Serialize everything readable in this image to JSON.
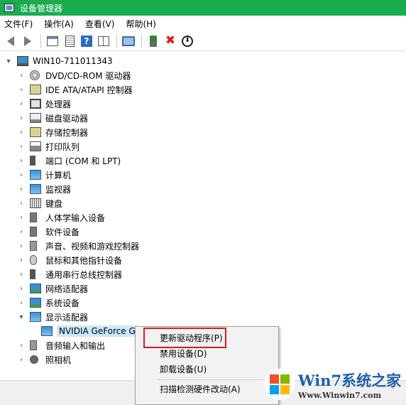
{
  "window": {
    "title": "设备管理器"
  },
  "menu": [
    "文件(F)",
    "操作(A)",
    "查看(V)",
    "帮助(H)"
  ],
  "toolbar": {
    "icons": [
      "back-arrow-icon",
      "forward-arrow-icon",
      "window-icon",
      "document-icon",
      "help-icon",
      "properties-icon",
      "monitor-icon",
      "enable-device-icon",
      "uninstall-x-icon",
      "download-circle-icon"
    ],
    "help_glyph": "?",
    "x_glyph": "✖",
    "down_glyph": "⬇"
  },
  "tree": {
    "root": "WIN10-711011343",
    "categories": [
      "DVD/CD-ROM 驱动器",
      "IDE ATA/ATAPI 控制器",
      "处理器",
      "磁盘驱动器",
      "存储控制器",
      "打印队列",
      "端口 (COM 和 LPT)",
      "计算机",
      "监视器",
      "键盘",
      "人体学输入设备",
      "软件设备",
      "声音、视频和游戏控制器",
      "鼠标和其他指针设备",
      "通用串行总线控制器",
      "网络适配器",
      "系统设备",
      "显示适配器"
    ],
    "child": "NVIDIA GeForce G",
    "after": [
      "音频输入和输出",
      "照相机"
    ]
  },
  "context_menu": {
    "items": [
      "更新驱动程序(P)",
      "禁用设备(D)",
      "卸载设备(U)",
      "扫描检测硬件改动(A)"
    ]
  },
  "watermark": {
    "brand": "Win7系统之家",
    "url": "Www.Winwin7.com"
  },
  "colors": {
    "titlebar": "#1aab4f",
    "selection": "#cce8ff",
    "highlight": "#e0191c"
  }
}
